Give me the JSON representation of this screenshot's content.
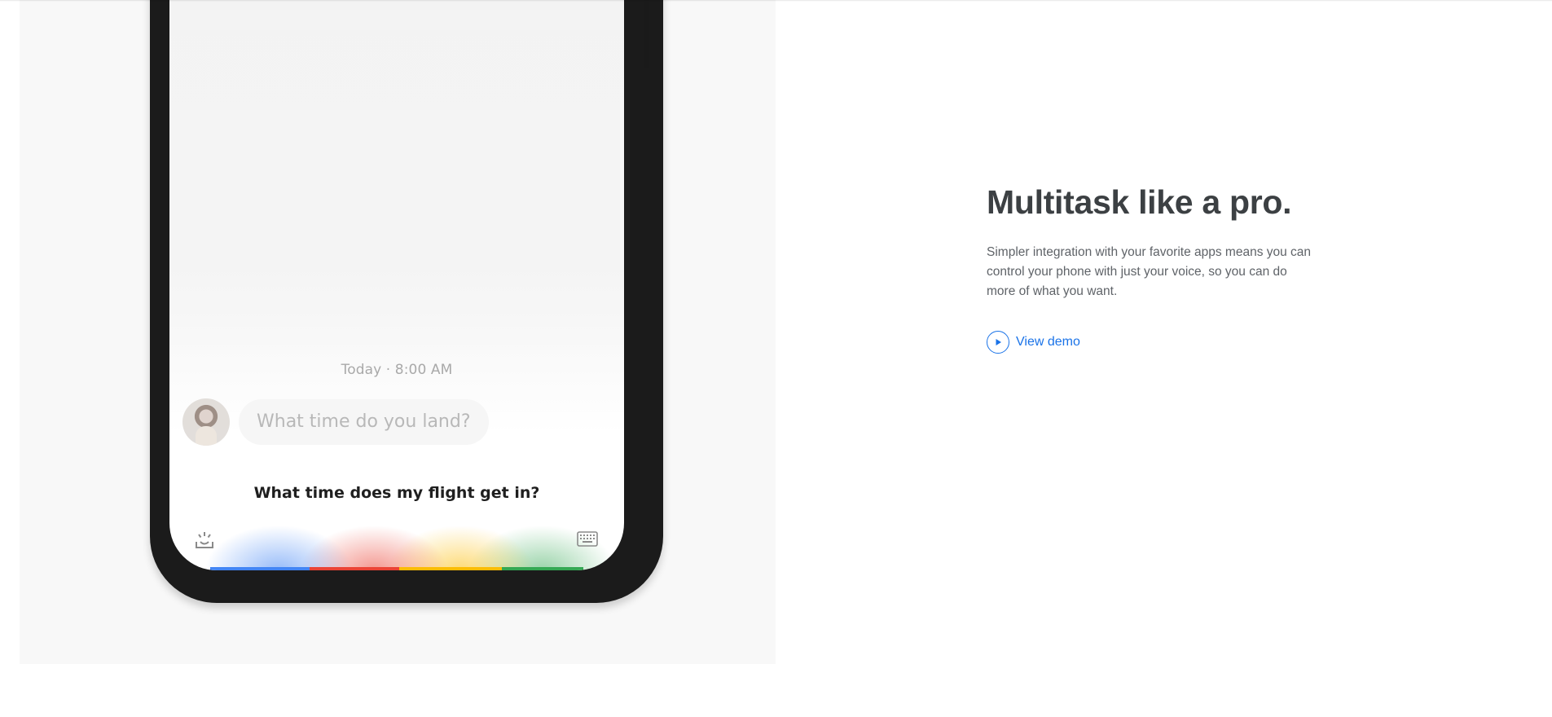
{
  "feature": {
    "title": "Multitask like a pro.",
    "description": "Simpler integration with your favorite apps means you can control your phone with just your voice, so you can do more of what you want.",
    "link_label": "View demo",
    "link_icon": "play-icon",
    "accent_color": "#1a73e8"
  },
  "phone_screen": {
    "timestamp": "Today · 8:00 AM",
    "incoming_message": "What time do you land?",
    "assistant_query": "What time does my flight get in?",
    "left_icon": "lens-icon",
    "right_icon": "keyboard-icon",
    "assistant_colors": [
      "#4285f4",
      "#ea4335",
      "#fbbc05",
      "#34a853"
    ]
  }
}
